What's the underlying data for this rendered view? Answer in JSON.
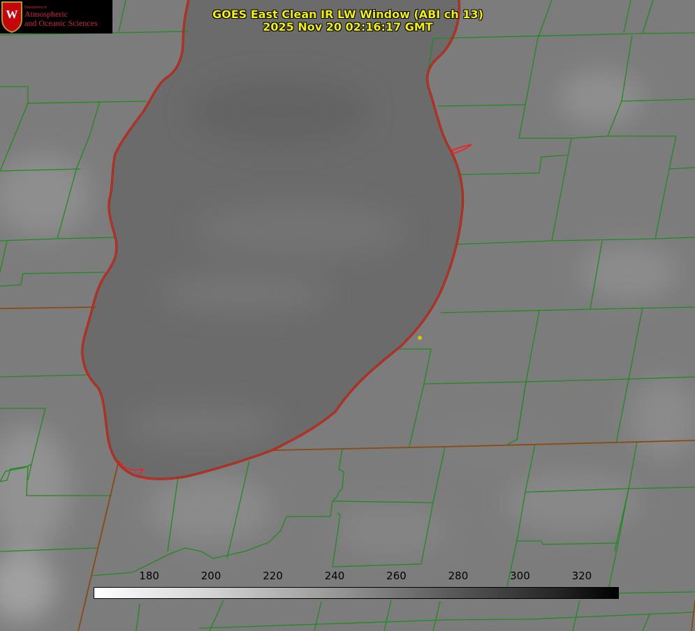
{
  "title": {
    "line1": "GOES East Clean IR LW Window (ABI ch 13)",
    "line2": "2025 Nov 20 02:16:17 GMT"
  },
  "logo": {
    "department": "Department of",
    "name_line1": "Atmospheric",
    "name_line2": "and Oceanic Sciences",
    "crest_letter": "W"
  },
  "colorbar": {
    "ticks": [
      "180",
      "200",
      "220",
      "240",
      "260",
      "280",
      "300",
      "320"
    ],
    "min": 162,
    "max": 332,
    "colormap": "white-to-black grayscale"
  },
  "colors": {
    "county_lines": "#1f8a1f",
    "state_borders": "#8a4a10",
    "shoreline": "#ff1a1a",
    "title_text": "#f2f200",
    "station_marker": "#d4c400"
  }
}
